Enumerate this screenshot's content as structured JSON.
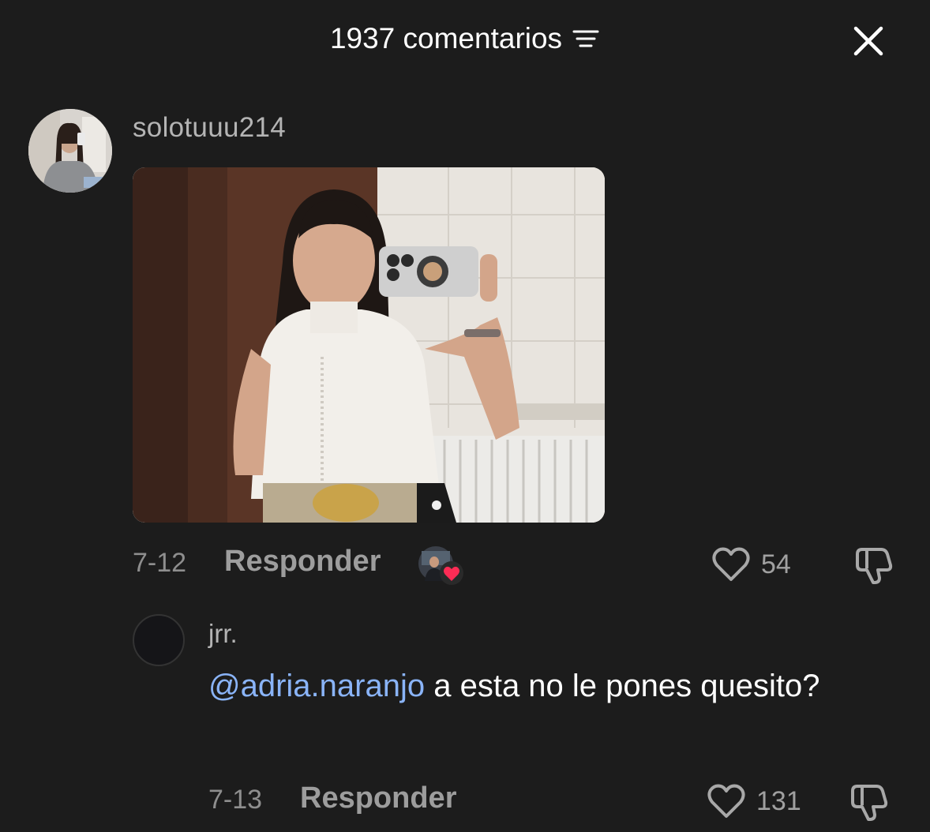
{
  "header": {
    "title": "1937 comentarios",
    "filter_icon": "sort-lines-icon",
    "close_icon": "close-x-icon"
  },
  "comments": [
    {
      "username": "solotuuu214",
      "date": "7-12",
      "reply_label": "Responder",
      "likes": "54",
      "has_photo": true,
      "creator_liked": true
    },
    {
      "username": "jrr.",
      "mention": "@adria.naranjo",
      "text": " a esta no le pones quesito?",
      "date": "7-13",
      "reply_label": "Responder",
      "likes": "131"
    }
  ],
  "colors": {
    "background": "#1c1c1c",
    "mention": "#8ab4f8",
    "heart_badge": "#fe2c55",
    "muted_text": "#9d9d9d"
  }
}
